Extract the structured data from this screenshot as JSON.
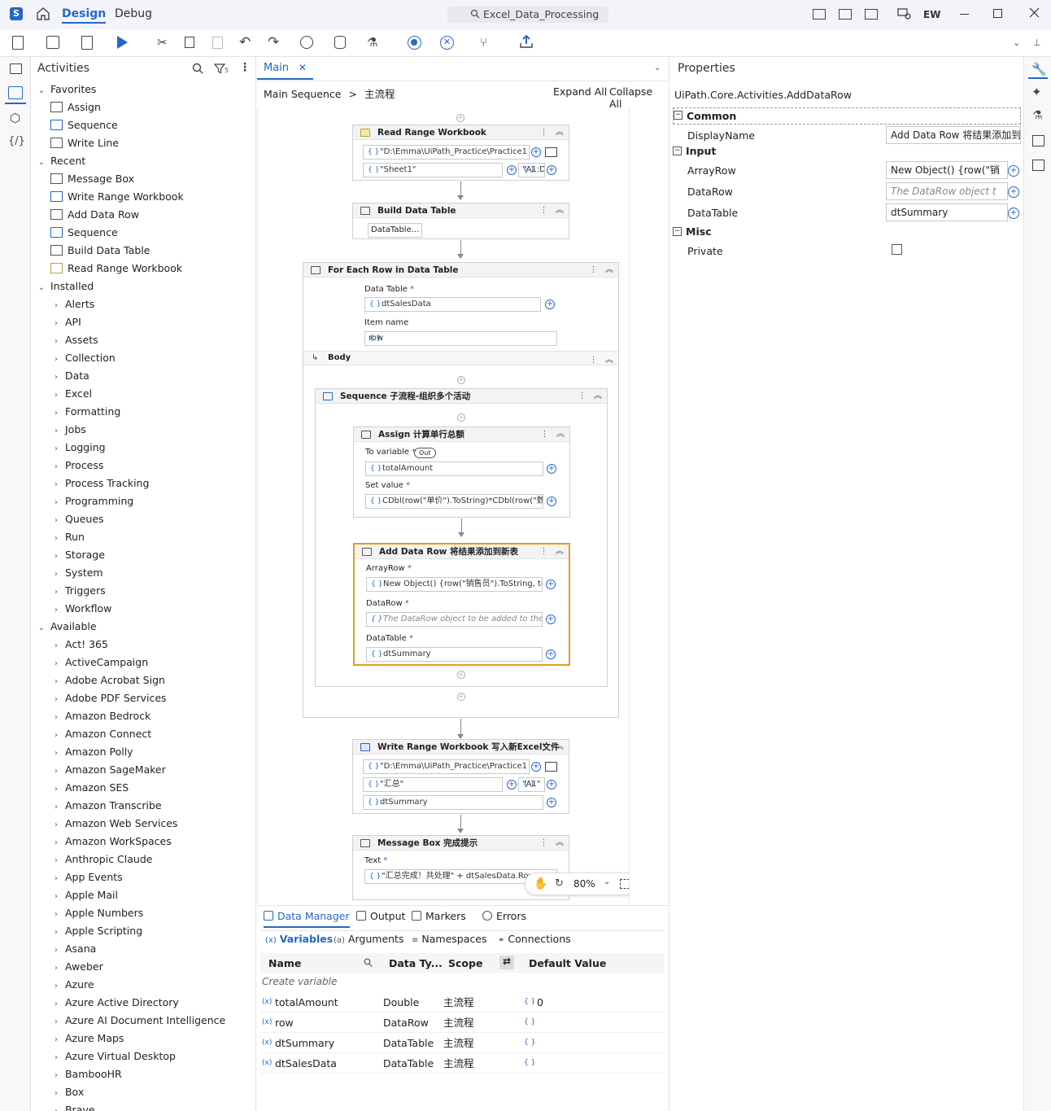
{
  "titlebar": {
    "design_tab": "Design",
    "debug_tab": "Debug",
    "search": "Excel_Data_Processing",
    "user": "EW"
  },
  "activities": {
    "title": "Activities",
    "filter_count": "5",
    "favorites_label": "Favorites",
    "favorites": [
      "Assign",
      "Sequence",
      "Write Line"
    ],
    "recent_label": "Recent",
    "recent": [
      "Message Box",
      "Write Range Workbook",
      "Add Data Row",
      "Sequence",
      "Build Data Table",
      "Read Range Workbook"
    ],
    "installed_label": "Installed",
    "installed": [
      "Alerts",
      "API",
      "Assets",
      "Collection",
      "Data",
      "Excel",
      "Formatting",
      "Jobs",
      "Logging",
      "Process",
      "Process Tracking",
      "Programming",
      "Queues",
      "Run",
      "Storage",
      "System",
      "Triggers",
      "Workflow"
    ],
    "available_label": "Available",
    "available": [
      "Act! 365",
      "ActiveCampaign",
      "Adobe Acrobat Sign",
      "Adobe PDF Services",
      "Amazon Bedrock",
      "Amazon Connect",
      "Amazon Polly",
      "Amazon SageMaker",
      "Amazon SES",
      "Amazon Transcribe",
      "Amazon Web Services",
      "Amazon WorkSpaces",
      "Anthropic Claude",
      "App Events",
      "Apple Mail",
      "Apple Numbers",
      "Apple Scripting",
      "Asana",
      "Aweber",
      "Azure",
      "Azure Active Directory",
      "Azure AI Document Intelligence",
      "Azure Maps",
      "Azure Virtual Desktop",
      "BambooHR",
      "Box",
      "Brave"
    ]
  },
  "designer": {
    "tab": "Main",
    "crumb1": "Main Sequence",
    "crumb_sep": ">",
    "crumb2": "主流程",
    "expand_all": "Expand All",
    "collapse_all": "Collapse All",
    "zoom": "80%"
  },
  "workflow": {
    "read_range": {
      "title": "Read Range Workbook",
      "path": "\"D:\\Emma\\UiPath_Practice\\Practice1",
      "sheet": "\"Sheet1\"",
      "range": "\"A1:D"
    },
    "build_dt": {
      "title": "Build Data Table",
      "button": "DataTable..."
    },
    "foreach": {
      "title": "For Each Row in Data Table",
      "dt_label": "Data Table",
      "dt_value": "dtSalesData",
      "item_label": "Item name",
      "item_value": "row",
      "body_label": "Body"
    },
    "sequence": {
      "title": "Sequence 子流程-组织多个活动"
    },
    "assign": {
      "title": "Assign 计算单行总额",
      "to_label": "To variable",
      "out_badge": "Out",
      "to_value": "totalAmount",
      "set_label": "Set value",
      "set_value": "CDbl(row(\"单价\").ToString)*CDbl(row(\"数"
    },
    "adddatarow": {
      "title": "Add Data Row 将结果添加到新表",
      "array_label": "ArrayRow",
      "array_value": "New Object() {row(\"销售员\").ToString, to",
      "datarow_label": "DataRow",
      "datarow_value": "The DataRow object to be added to the Da",
      "dt_label": "DataTable",
      "dt_value": "dtSummary"
    },
    "write_range": {
      "title": "Write Range Workbook 写入新Excel文件",
      "path": "\"D:\\Emma\\UiPath_Practice\\Practice1",
      "sheet": "\"汇总\"",
      "range": "\"A1\"",
      "dt": "dtSummary"
    },
    "msgbox": {
      "title": "Message Box 完成提示",
      "text_label": "Text",
      "text_value": "\"汇总完成！共处理\" + dtSalesData.Rows"
    }
  },
  "properties": {
    "title": "Properties",
    "type": "UiPath.Core.Activities.AddDataRow",
    "common": "Common",
    "display_name_label": "DisplayName",
    "display_name_value": "Add Data Row 将结果添加到新",
    "input": "Input",
    "arrayrow_label": "ArrayRow",
    "arrayrow_value": "New Object() {row(\"销",
    "datarow_label": "DataRow",
    "datarow_value": "The DataRow object t",
    "datatable_label": "DataTable",
    "datatable_value": "dtSummary",
    "misc": "Misc",
    "private_label": "Private"
  },
  "bottom": {
    "tabs": [
      "Data Manager",
      "Output",
      "Markers",
      "Errors"
    ],
    "subtabs": [
      "Variables",
      "Arguments",
      "Namespaces",
      "Connections"
    ],
    "headers": {
      "name": "Name",
      "type": "Data Ty...",
      "scope": "Scope",
      "default": "Default Value"
    },
    "create": "Create variable",
    "rows": [
      {
        "name": "totalAmount",
        "type": "Double",
        "scope": "主流程",
        "default": "0"
      },
      {
        "name": "row",
        "type": "DataRow",
        "scope": "主流程",
        "default": ""
      },
      {
        "name": "dtSummary",
        "type": "DataTable",
        "scope": "主流程",
        "default": ""
      },
      {
        "name": "dtSalesData",
        "type": "DataTable",
        "scope": "主流程",
        "default": ""
      }
    ]
  },
  "colors": {
    "accent": "#2667c7",
    "selected_border": "#e49b1f"
  }
}
